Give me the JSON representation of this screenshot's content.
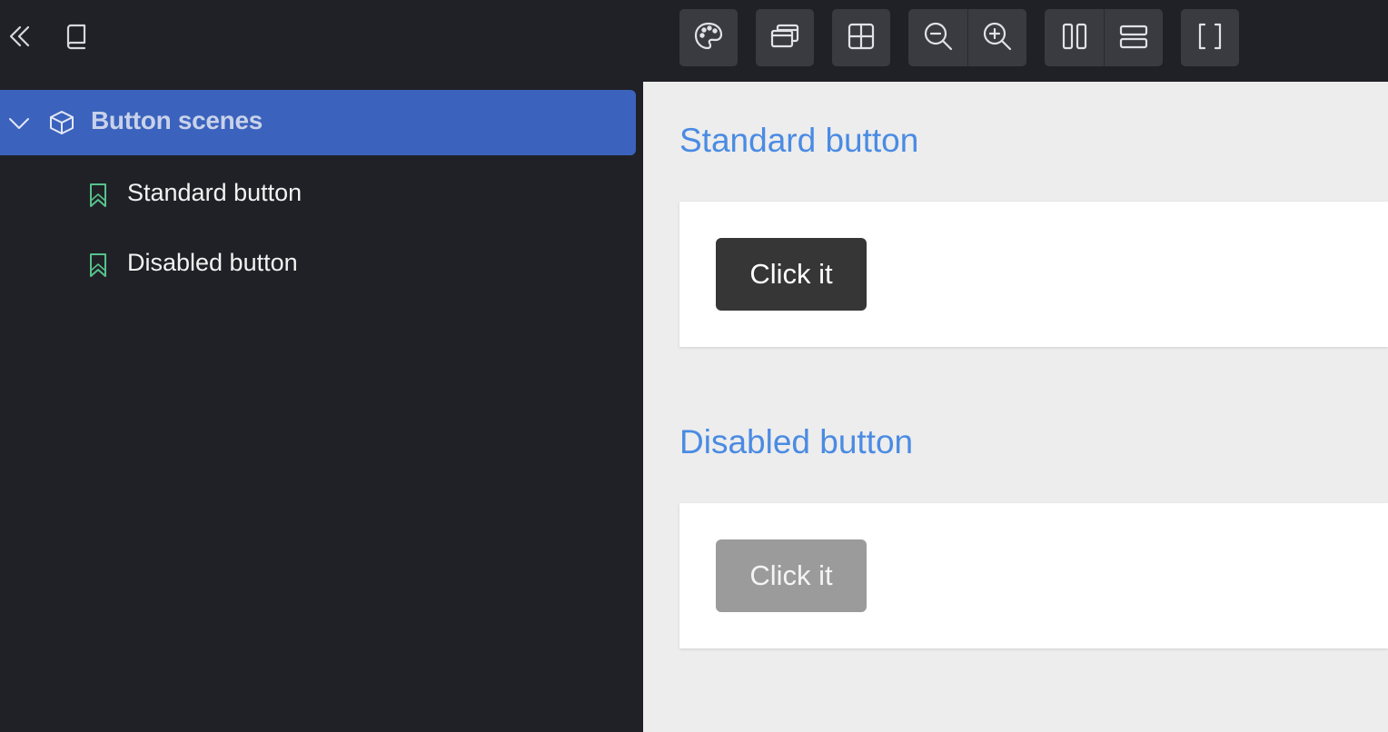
{
  "topbar": {
    "left_icons": [
      "collapse-sidebar-icon",
      "book-icon"
    ],
    "tools": [
      [
        "palette-icon"
      ],
      [
        "windows-icon"
      ],
      [
        "grid-icon"
      ],
      [
        "zoom-out-icon",
        "zoom-in-icon"
      ],
      [
        "split-columns-icon",
        "split-rows-icon"
      ],
      [
        "fullscreen-brackets-icon"
      ]
    ]
  },
  "sidebar": {
    "group_label": "Button scenes",
    "group_expanded": true,
    "stories": [
      {
        "label": "Standard button"
      },
      {
        "label": "Disabled button"
      }
    ]
  },
  "canvas": {
    "scenes": [
      {
        "title": "Standard button",
        "button_label": "Click it",
        "disabled": false
      },
      {
        "title": "Disabled button",
        "button_label": "Click it",
        "disabled": true
      }
    ]
  },
  "colors": {
    "selected_bg": "#3b63bd",
    "title_blue": "#4a8be3",
    "bookmark_green": "#56c28d",
    "standard_button": "#363636",
    "disabled_button": "#9b9b9b"
  }
}
